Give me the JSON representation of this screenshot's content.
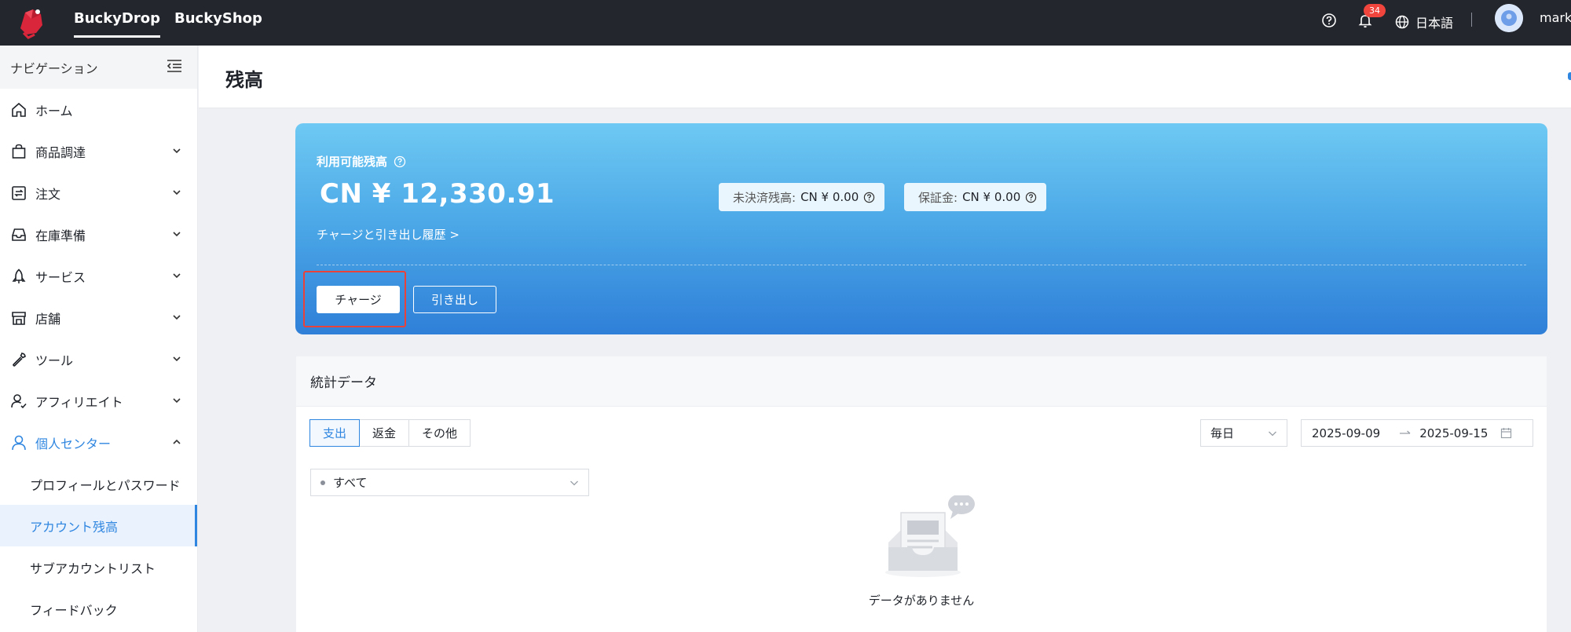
{
  "topbar": {
    "tabs": [
      "BuckyDrop",
      "BuckyShop"
    ],
    "notification_count": "34",
    "language": "日本語",
    "user_name": "mark"
  },
  "sidebar": {
    "header": "ナビゲーション",
    "items": [
      {
        "label": "ホーム",
        "icon": "home-icon"
      },
      {
        "label": "商品調達",
        "icon": "shopping-bag-icon"
      },
      {
        "label": "注文",
        "icon": "order-icon"
      },
      {
        "label": "在庫準備",
        "icon": "inbox-icon"
      },
      {
        "label": "サービス",
        "icon": "service-icon"
      },
      {
        "label": "店舗",
        "icon": "store-icon"
      },
      {
        "label": "ツール",
        "icon": "wrench-icon"
      },
      {
        "label": "アフィリエイト",
        "icon": "affiliate-icon"
      },
      {
        "label": "個人センター",
        "icon": "user-icon"
      }
    ],
    "sub_items": [
      "プロフィールとパスワード",
      "アカウント残高",
      "サブアカウントリスト",
      "フィードバック"
    ],
    "active_sub": "アカウント残高"
  },
  "page": {
    "title": "残高"
  },
  "balance": {
    "label": "利用可能残高",
    "amount": "CN ¥ 12,330.91",
    "history_link": "チャージと引き出し履歴 >",
    "pending_label": "未決済残高:",
    "pending_value": "CN ¥ 0.00",
    "deposit_label": "保証金:",
    "deposit_value": "CN ¥ 0.00",
    "charge_button": "チャージ",
    "withdraw_button": "引き出し"
  },
  "stats": {
    "title": "統計データ",
    "segments": [
      "支出",
      "返金",
      "その他"
    ],
    "active_segment": "支出",
    "period": "毎日",
    "date_start": "2025-09-09",
    "date_end": "2025-09-15",
    "filter": "すべて",
    "empty_text": "データがありません"
  },
  "colors": {
    "accent": "#2f86e0",
    "topbar": "#23262d",
    "highlight": "#e8423a"
  }
}
